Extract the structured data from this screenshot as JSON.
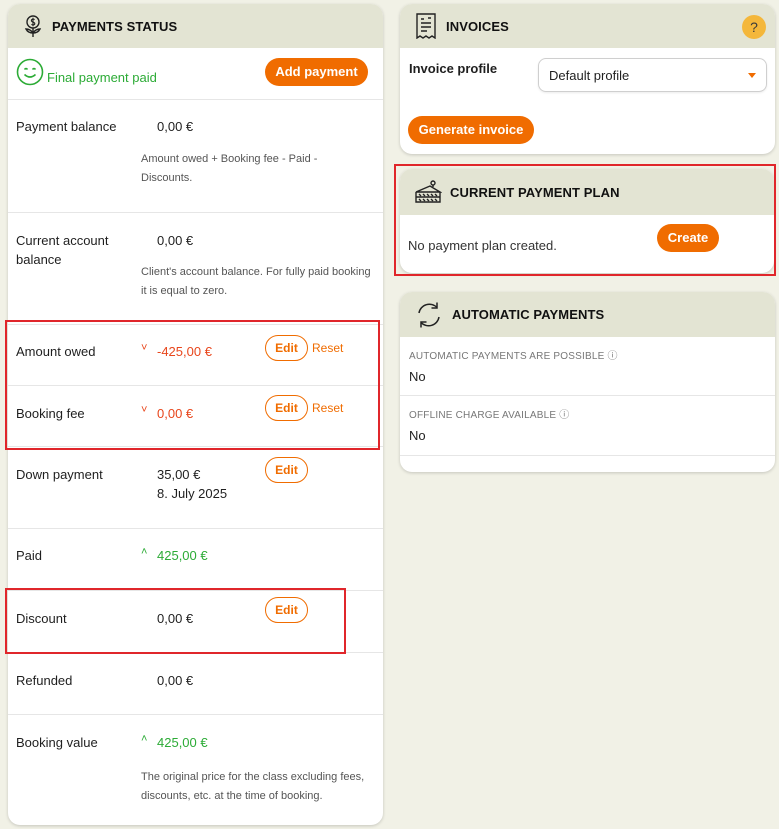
{
  "payments": {
    "title": "PAYMENTS STATUS",
    "status_text": "Final payment paid",
    "add_payment_label": "Add payment",
    "edit_label": "Edit",
    "reset_label": "Reset",
    "rows": {
      "payment_balance": {
        "label": "Payment balance",
        "value": "0,00 €",
        "note": "Amount owed + Booking fee - Paid - Discounts."
      },
      "current_account_balance": {
        "label_line1": "Current account",
        "label_line2": "balance",
        "value": "0,00 €",
        "note": "Client's account balance. For fully paid booking it is equal to zero."
      },
      "amount_owed": {
        "label": "Amount owed",
        "value": "-425,00 €"
      },
      "booking_fee": {
        "label": "Booking fee",
        "value": "0,00 €"
      },
      "down_payment": {
        "label": "Down payment",
        "value": "35,00 €",
        "date": "8. July 2025"
      },
      "paid": {
        "label": "Paid",
        "value": "425,00 €"
      },
      "discount": {
        "label": "Discount",
        "value": "0,00 €"
      },
      "refunded": {
        "label": "Refunded",
        "value": "0,00 €"
      },
      "booking_value": {
        "label": "Booking value",
        "value": "425,00 €",
        "note": "The original price for the class excluding fees, discounts, etc. at the time of booking."
      }
    },
    "arrow_down": "˅",
    "arrow_up": "˄"
  },
  "invoices": {
    "title": "INVOICES",
    "help": "?",
    "profile_label": "Invoice profile",
    "profile_value": "Default profile",
    "generate_label": "Generate invoice"
  },
  "plan": {
    "title": "CURRENT PAYMENT PLAN",
    "empty_text": "No payment plan created.",
    "create_label": "Create"
  },
  "auto": {
    "title": "AUTOMATIC PAYMENTS",
    "possible_caption": "AUTOMATIC PAYMENTS ARE POSSIBLE ⓘ",
    "possible_value": "No",
    "offline_caption": "OFFLINE CHARGE AVAILABLE ⓘ",
    "offline_value": "No"
  },
  "colors": {
    "accent": "#f06c00",
    "negative": "#e8461c",
    "positive": "#2cab36",
    "highlight": "#e0262b",
    "header_bg": "#e3e4d3",
    "page_bg": "#f1f1e6"
  }
}
